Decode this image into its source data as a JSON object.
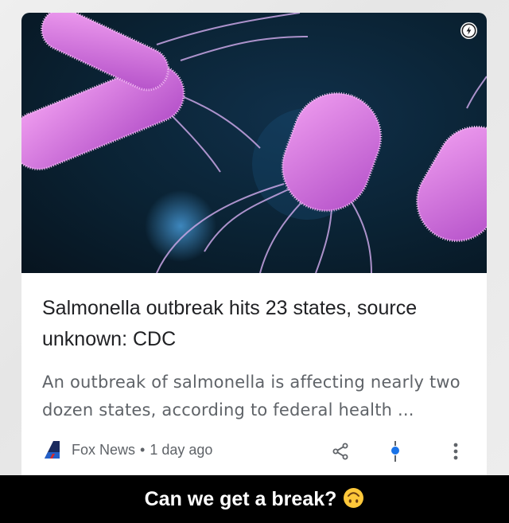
{
  "card": {
    "headline": "Salmonella outbreak hits 23 states, source unknown: CDC",
    "snippet": "An outbreak of salmonella is affecting nearly two dozen states, according to federal health ...",
    "source": "Fox News",
    "separator": "•",
    "age": "1 day ago",
    "hero_image": "bacteria-illustration",
    "badge_icon": "amp-lightning-icon",
    "actions": [
      "share-icon",
      "pin-icon",
      "more-vertical-icon"
    ]
  },
  "caption": {
    "text": "Can we get a break?",
    "emoji": "upside-down-face-emoji"
  },
  "colors": {
    "headline": "#202124",
    "secondary": "#5f6368",
    "caption_bg": "#000000",
    "accent_blue": "#1a73e8"
  }
}
